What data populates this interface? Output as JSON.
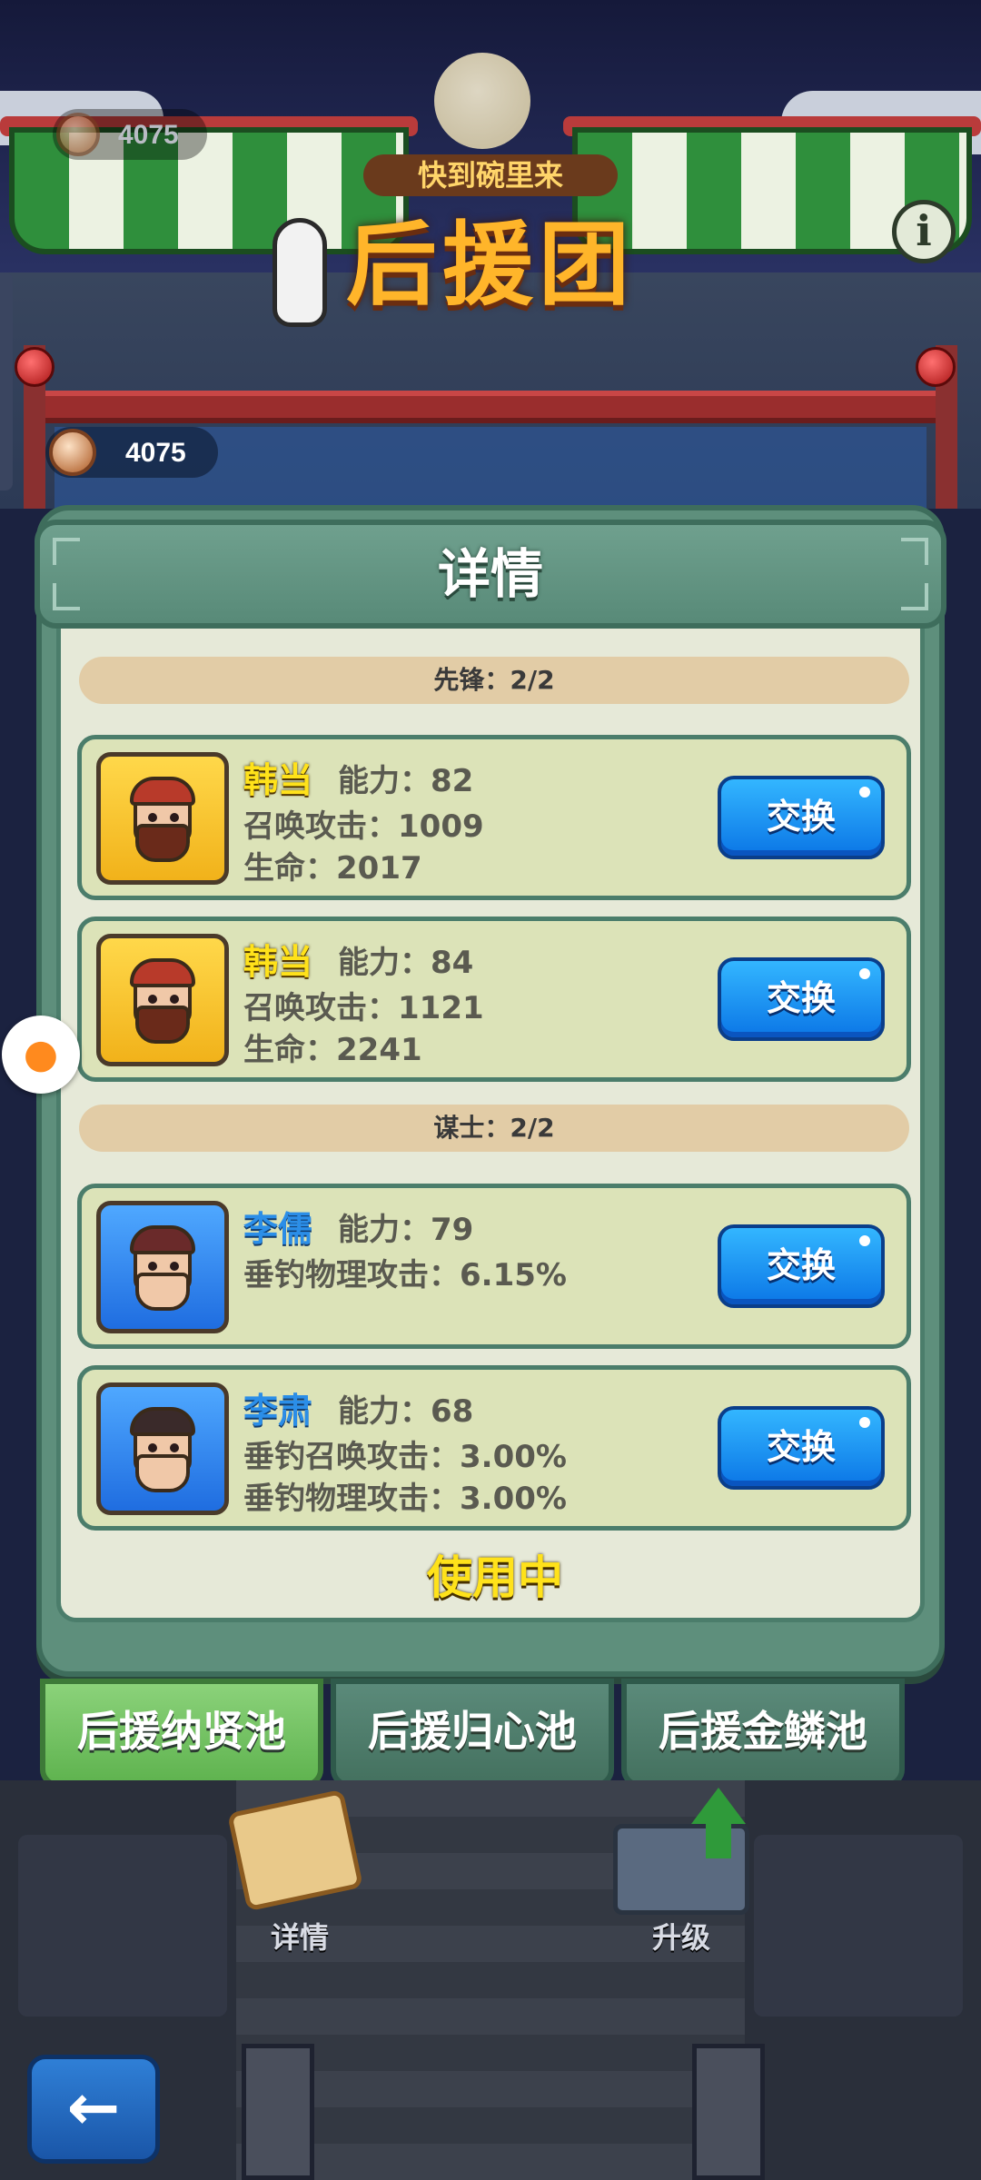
{
  "header": {
    "sign_subtitle": "快到碗里来",
    "sign_title": "后援团",
    "coins_top": "4075",
    "coins_mid": "4075",
    "info_icon": "info-icon"
  },
  "dialog": {
    "title": "详情",
    "sections": [
      {
        "label": "先锋：2/2",
        "heroes": [
          {
            "name": "韩当",
            "rarity": "gold",
            "ability": "能力：82",
            "stats": [
              "召唤攻击：1009",
              "生命：2017"
            ],
            "action": "交换"
          },
          {
            "name": "韩当",
            "rarity": "gold",
            "ability": "能力：84",
            "stats": [
              "召唤攻击：1121",
              "生命：2241"
            ],
            "action": "交换"
          }
        ]
      },
      {
        "label": "谋士：2/2",
        "heroes": [
          {
            "name": "李儒",
            "rarity": "blue",
            "ability": "能力：79",
            "stats": [
              "垂钓物理攻击：6.15%"
            ],
            "action": "交换"
          },
          {
            "name": "李肃",
            "rarity": "blue",
            "ability": "能力：68",
            "stats": [
              "垂钓召唤攻击：3.00%",
              "垂钓物理攻击：3.00%"
            ],
            "action": "交换"
          }
        ]
      }
    ],
    "status": "使用中"
  },
  "tabs": [
    {
      "label": "后援纳贤池",
      "active": true
    },
    {
      "label": "后援归心池",
      "active": false
    },
    {
      "label": "后援金鳞池",
      "active": false
    }
  ],
  "bottom_menu": {
    "details_label": "详情",
    "upgrade_label": "升级"
  },
  "colors": {
    "gold_name": "#ffe21a",
    "blue_name": "#2b8ee8",
    "swap_button": "#1f8ff0",
    "active_tab": "#6fbf5e",
    "dialog_frame": "#5e8f7c"
  }
}
